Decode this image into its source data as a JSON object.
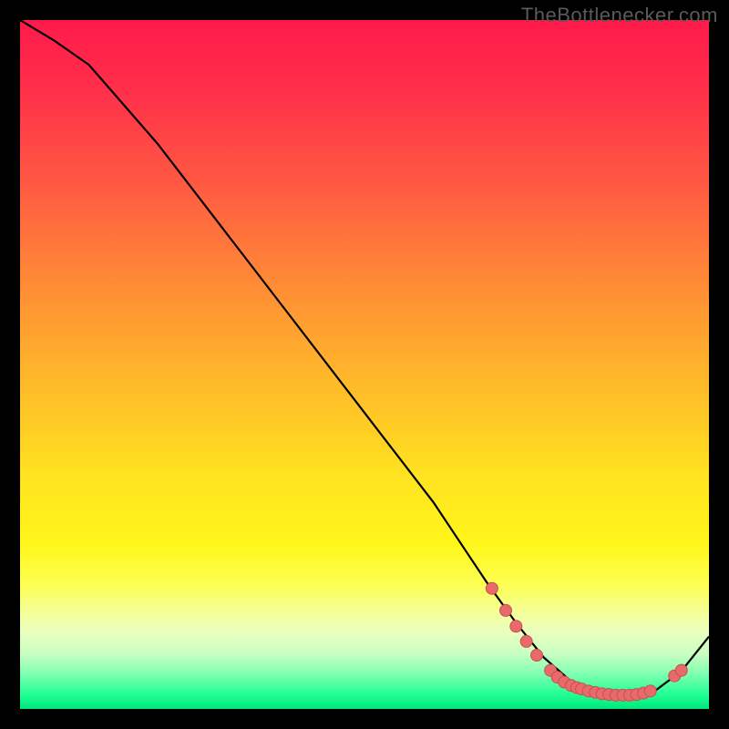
{
  "watermark": "TheBottlenecker.com",
  "colors": {
    "curve": "#000000",
    "dot_fill": "#e86a6a",
    "dot_stroke": "#c94f4f"
  },
  "chart_data": {
    "type": "line",
    "title": "",
    "xlabel": "",
    "ylabel": "",
    "xlim": [
      0,
      100
    ],
    "ylim": [
      0,
      100
    ],
    "curve": {
      "x": [
        0,
        5,
        10,
        20,
        30,
        40,
        50,
        60,
        68,
        72,
        76,
        80,
        84,
        88,
        92,
        96,
        100
      ],
      "y": [
        100,
        97,
        93.5,
        82,
        69,
        56,
        43,
        30,
        18,
        12.5,
        7.5,
        4.0,
        2.2,
        1.8,
        2.5,
        5.5,
        10.5
      ]
    },
    "series": [
      {
        "name": "highlight-dots",
        "points": [
          {
            "x": 68.5,
            "y": 17.5
          },
          {
            "x": 70.5,
            "y": 14.3
          },
          {
            "x": 72.0,
            "y": 12.0
          },
          {
            "x": 73.5,
            "y": 9.8
          },
          {
            "x": 75.0,
            "y": 7.8
          },
          {
            "x": 77.0,
            "y": 5.6
          },
          {
            "x": 78.0,
            "y": 4.6
          },
          {
            "x": 79.0,
            "y": 3.9
          },
          {
            "x": 80.0,
            "y": 3.4
          },
          {
            "x": 80.8,
            "y": 3.1
          },
          {
            "x": 81.5,
            "y": 2.9
          },
          {
            "x": 82.5,
            "y": 2.6
          },
          {
            "x": 83.5,
            "y": 2.4
          },
          {
            "x": 84.5,
            "y": 2.2
          },
          {
            "x": 85.5,
            "y": 2.1
          },
          {
            "x": 86.5,
            "y": 2.0
          },
          {
            "x": 87.5,
            "y": 2.0
          },
          {
            "x": 88.5,
            "y": 2.0
          },
          {
            "x": 89.5,
            "y": 2.1
          },
          {
            "x": 90.5,
            "y": 2.3
          },
          {
            "x": 91.5,
            "y": 2.6
          },
          {
            "x": 95.0,
            "y": 4.8
          },
          {
            "x": 96.0,
            "y": 5.6
          }
        ]
      }
    ]
  }
}
